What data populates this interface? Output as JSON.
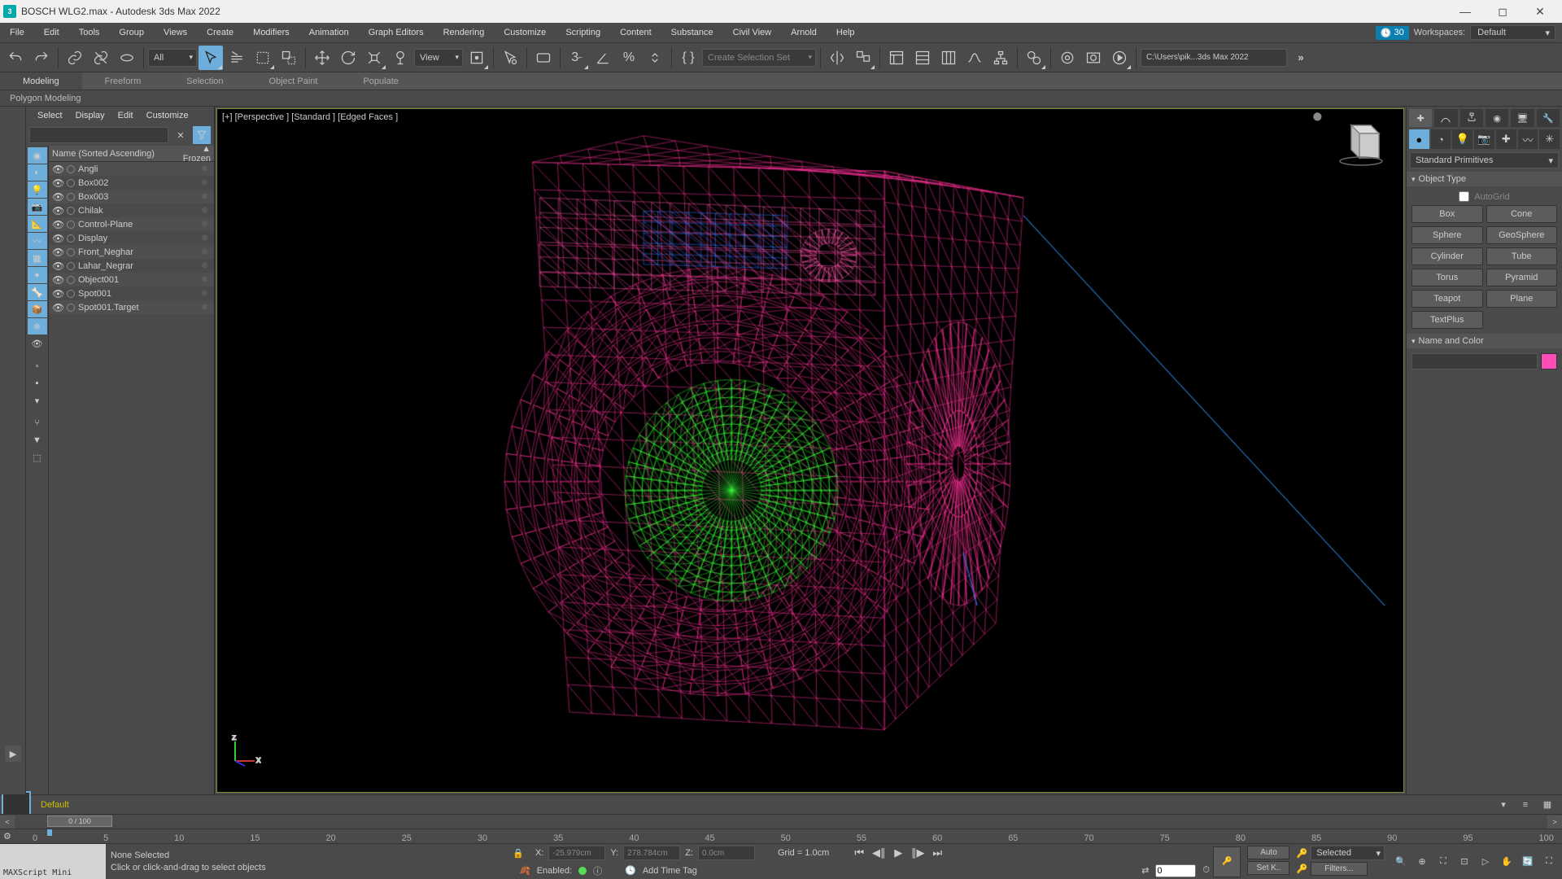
{
  "title": "BOSCH WLG2.max - Autodesk 3ds Max 2022",
  "menus": [
    "File",
    "Edit",
    "Tools",
    "Group",
    "Views",
    "Create",
    "Modifiers",
    "Animation",
    "Graph Editors",
    "Rendering",
    "Customize",
    "Scripting",
    "Content",
    "Substance",
    "Civil View",
    "Arnold",
    "Help"
  ],
  "workspace": {
    "badge": "30",
    "label": "Workspaces:",
    "value": "Default"
  },
  "toolbar": {
    "allDrop": "All",
    "viewDrop": "View",
    "selSet": "Create Selection Set",
    "filepath": "C:\\Users\\pik...3ds Max 2022"
  },
  "ribbon": {
    "tabs": [
      "Modeling",
      "Freeform",
      "Selection",
      "Object Paint",
      "Populate"
    ],
    "panel": "Polygon Modeling"
  },
  "sceneExplorer": {
    "menus": [
      "Select",
      "Display",
      "Edit",
      "Customize"
    ],
    "headerName": "Name (Sorted Ascending)",
    "headerFrozen": "▲ Frozen",
    "items": [
      {
        "name": "Angli"
      },
      {
        "name": "Box002"
      },
      {
        "name": "Box003"
      },
      {
        "name": "Chilak"
      },
      {
        "name": "Control-Plane"
      },
      {
        "name": "Display"
      },
      {
        "name": "Front_Neghar"
      },
      {
        "name": "Lahar_Negrar"
      },
      {
        "name": "Object001"
      },
      {
        "name": "Spot001"
      },
      {
        "name": "Spot001.Target"
      }
    ]
  },
  "viewport": {
    "label": "[+] [Perspective ] [Standard ] [Edged Faces ]"
  },
  "commandPanel": {
    "category": "Standard Primitives",
    "objectType": "Object Type",
    "autoGrid": "AutoGrid",
    "buttons": [
      [
        "Box",
        "Cone"
      ],
      [
        "Sphere",
        "GeoSphere"
      ],
      [
        "Cylinder",
        "Tube"
      ],
      [
        "Torus",
        "Pyramid"
      ],
      [
        "Teapot",
        "Plane"
      ],
      [
        "TextPlus",
        ""
      ]
    ],
    "nameColor": "Name and Color"
  },
  "trackbar": {
    "layer": "Default"
  },
  "timeline": {
    "frame": "0 / 100",
    "ticks": [
      "0",
      "5",
      "10",
      "15",
      "20",
      "25",
      "30",
      "35",
      "40",
      "45",
      "50",
      "55",
      "60",
      "65",
      "70",
      "75",
      "80",
      "85",
      "90",
      "95",
      "100"
    ]
  },
  "status": {
    "maxscript": "MAXScript Mini",
    "selection": "None Selected",
    "prompt": "Click or click-and-drag to select objects",
    "x": "-25.979cm",
    "y": "278.784cm",
    "z": "0.0cm",
    "grid": "Grid = 1.0cm",
    "enabled": "Enabled:",
    "addTimeTag": "Add Time Tag",
    "curFrame": "0",
    "auto": "Auto",
    "setk": "Set K..",
    "selected": "Selected",
    "filters": "Filters..."
  }
}
